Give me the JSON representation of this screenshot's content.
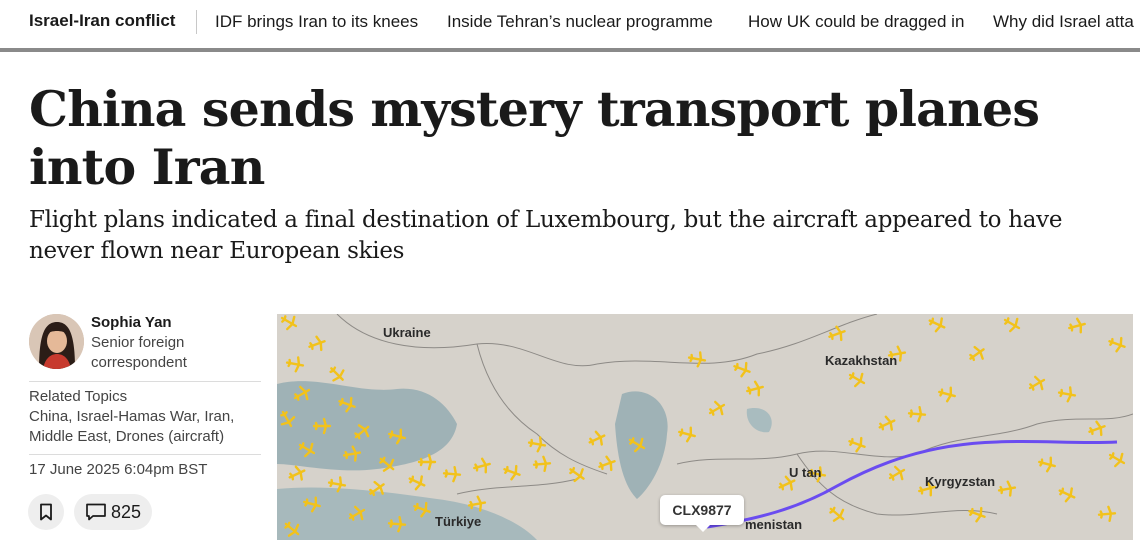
{
  "topnav": {
    "topic": "Israel-Iran conflict",
    "links": [
      "IDF brings Iran to its knees",
      "Inside Tehran’s nuclear programme",
      "How UK could be dragged in",
      "Why did Israel atta"
    ]
  },
  "article": {
    "headline": "China sends mystery transport planes into Iran",
    "standfirst": "Flight plans indicated a final destination of Luxembourg, but the aircraft appeared to have never flown near European skies"
  },
  "author": {
    "name": "Sophia Yan",
    "role": "Senior foreign correspondent"
  },
  "related": {
    "label": "Related Topics",
    "topics": "China, Israel-Hamas War, Iran, Middle East, Drones (aircraft)"
  },
  "meta": {
    "date": "17 June 2025 6:04pm BST",
    "comment_count": "825"
  },
  "map": {
    "labels": {
      "ukraine": "Ukraine",
      "kazakhstan": "Kazakhstan",
      "uzbekistan": "U    tan",
      "kyrgyzstan": "Kyrgyzstan",
      "turkmenistan": "menistan",
      "turkiye": "Türkiye"
    },
    "flight_callout": "CLX9877",
    "colors": {
      "land": "#d6d2cb",
      "sea": "#9fb2b6",
      "route": "#6a4cf0",
      "plane": "#f2c21b"
    }
  },
  "icons": {
    "bookmark": "bookmark-icon",
    "comment": "comment-icon"
  }
}
